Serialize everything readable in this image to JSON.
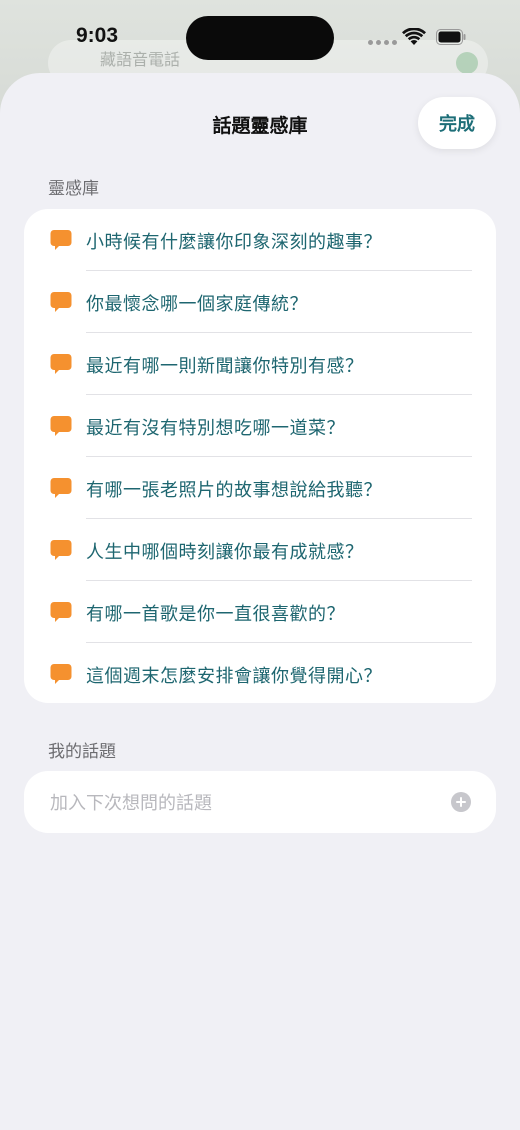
{
  "status_bar": {
    "time": "9:03"
  },
  "background_app": {
    "input_text": "藏語音電話"
  },
  "sheet": {
    "title": "話題靈感庫",
    "done_label": "完成"
  },
  "inspiration": {
    "header": "靈感庫",
    "icon": "speech-bubble-icon",
    "accent_color": "#f5912f",
    "items": [
      {
        "label": "小時候有什麼讓你印象深刻的趣事？"
      },
      {
        "label": "你最懷念哪一個家庭傳統？"
      },
      {
        "label": "最近有哪一則新聞讓你特別有感？"
      },
      {
        "label": "最近有沒有特別想吃哪一道菜？"
      },
      {
        "label": "有哪一張老照片的故事想說給我聽？"
      },
      {
        "label": "人生中哪個時刻讓你最有成就感？"
      },
      {
        "label": "有哪一首歌是你一直很喜歡的？"
      },
      {
        "label": "這個週末怎麼安排會讓你覺得開心？"
      }
    ]
  },
  "my_topics": {
    "header": "我的話題",
    "input_placeholder": "加入下次想問的話題",
    "input_value": "",
    "add_icon": "plus-circle-icon"
  },
  "colors": {
    "text_accent": "#1e6670",
    "done_text": "#1d6e78",
    "sheet_background": "#f0f0f5"
  }
}
